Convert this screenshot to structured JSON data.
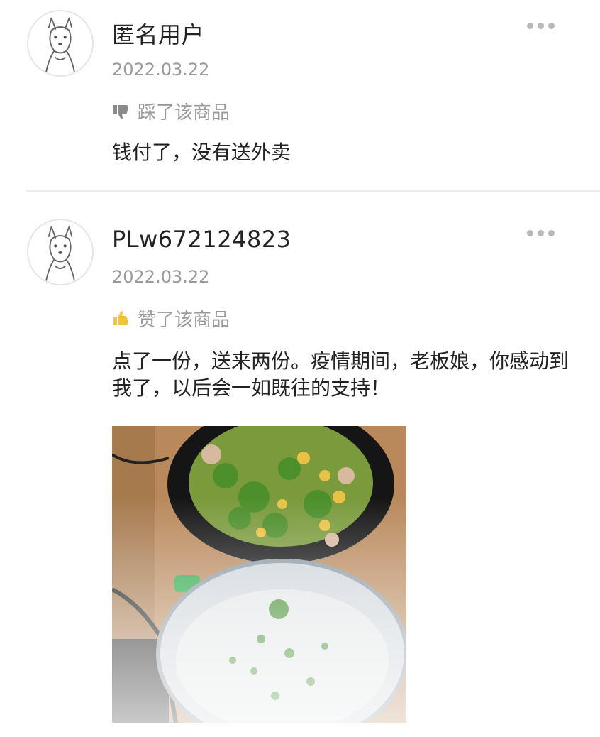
{
  "reviews": [
    {
      "username": "匿名用户",
      "date": "2022.03.22",
      "rating_icon": "thumbs-down-icon",
      "rating_label": "踩了该商品",
      "content": "钱付了，没有送外卖"
    },
    {
      "username": "PLw672124823",
      "date": "2022.03.22",
      "rating_icon": "thumbs-up-icon",
      "rating_label": "赞了该商品",
      "rating_color": "#f5c33b",
      "content": "点了一份，送来两份。疫情期间，老板娘，你感动到我了，以后会一如既往的支持！",
      "photo": "food-photo"
    }
  ],
  "colors": {
    "username": "#222222",
    "muted": "#9a9a9a",
    "thumbs_up": "#f5c33b",
    "thumbs_down": "#8a8a8a"
  }
}
